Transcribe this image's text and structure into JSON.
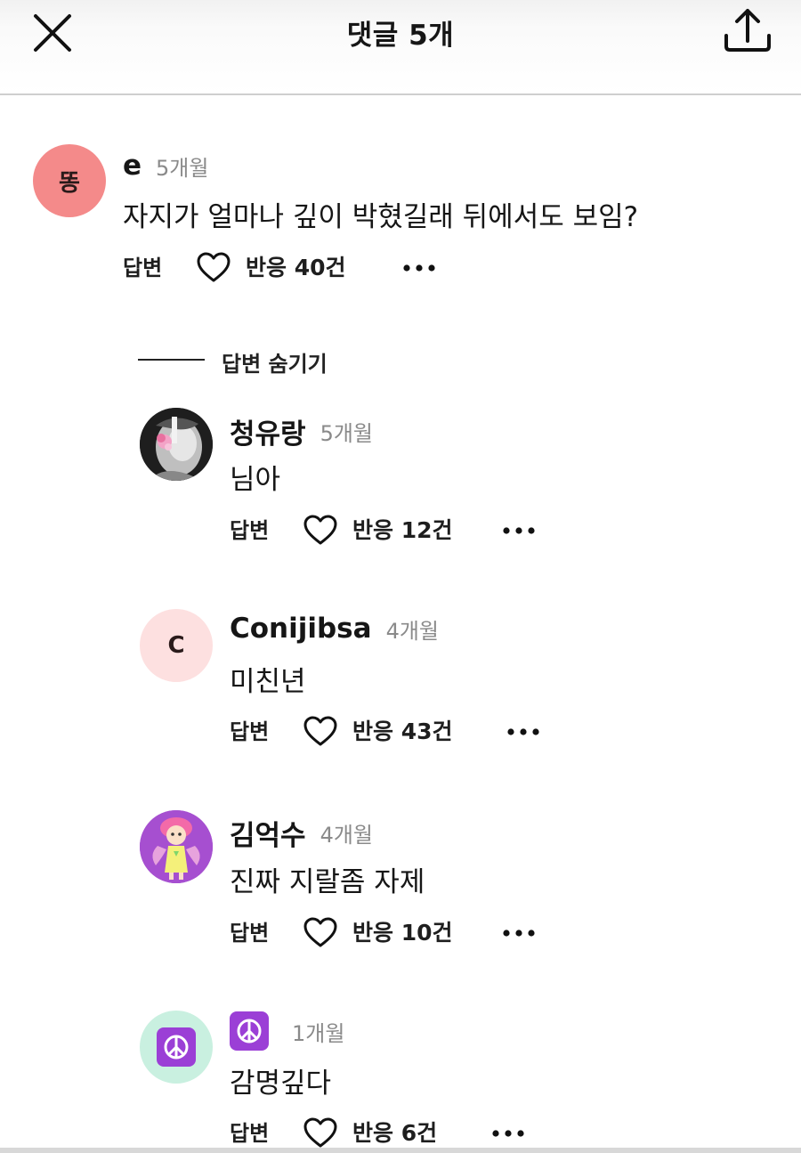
{
  "header": {
    "title": "댓글 5개",
    "close_icon": "close-icon",
    "share_icon": "share-upload-icon"
  },
  "comments": [
    {
      "avatar_text": "똥",
      "avatar_color": "#f48a8a",
      "name": "e",
      "time": "5개월",
      "text": "자지가 얼마나 깊이 박혔길래 뒤에서도 보임?",
      "reply_label": "답변",
      "reactions": "반응 40건"
    }
  ],
  "hide_replies_label": "답변 숨기기",
  "replies": [
    {
      "avatar_type": "photo",
      "avatar_desc": "black-and-white portrait with pink flower",
      "name": "청유랑",
      "time": "5개월",
      "text": "님아",
      "reply_label": "답변",
      "reactions": "반응 12건"
    },
    {
      "avatar_text": "C",
      "avatar_color": "#fde0e0",
      "name": "Conijibsa",
      "time": "4개월",
      "text": "미친년",
      "reply_label": "답변",
      "reactions": "반응 43건"
    },
    {
      "avatar_type": "illustration",
      "avatar_desc": "pink-haired anime fairy character on purple",
      "name": "김억수",
      "time": "4개월",
      "text": "진짜 지랄좀 자제",
      "reply_label": "답변",
      "reactions": "반응 10건"
    },
    {
      "avatar_type": "emoji",
      "avatar_emoji": "☮",
      "avatar_color": "#c9f0e0",
      "name": "☮",
      "time": "1개월",
      "text": "감명깊다",
      "reply_label": "답변",
      "reactions": "반응 6건"
    }
  ],
  "colors": {
    "text": "#161616",
    "muted": "#8a8a8a",
    "peace_purple": "#9b3fd6"
  }
}
